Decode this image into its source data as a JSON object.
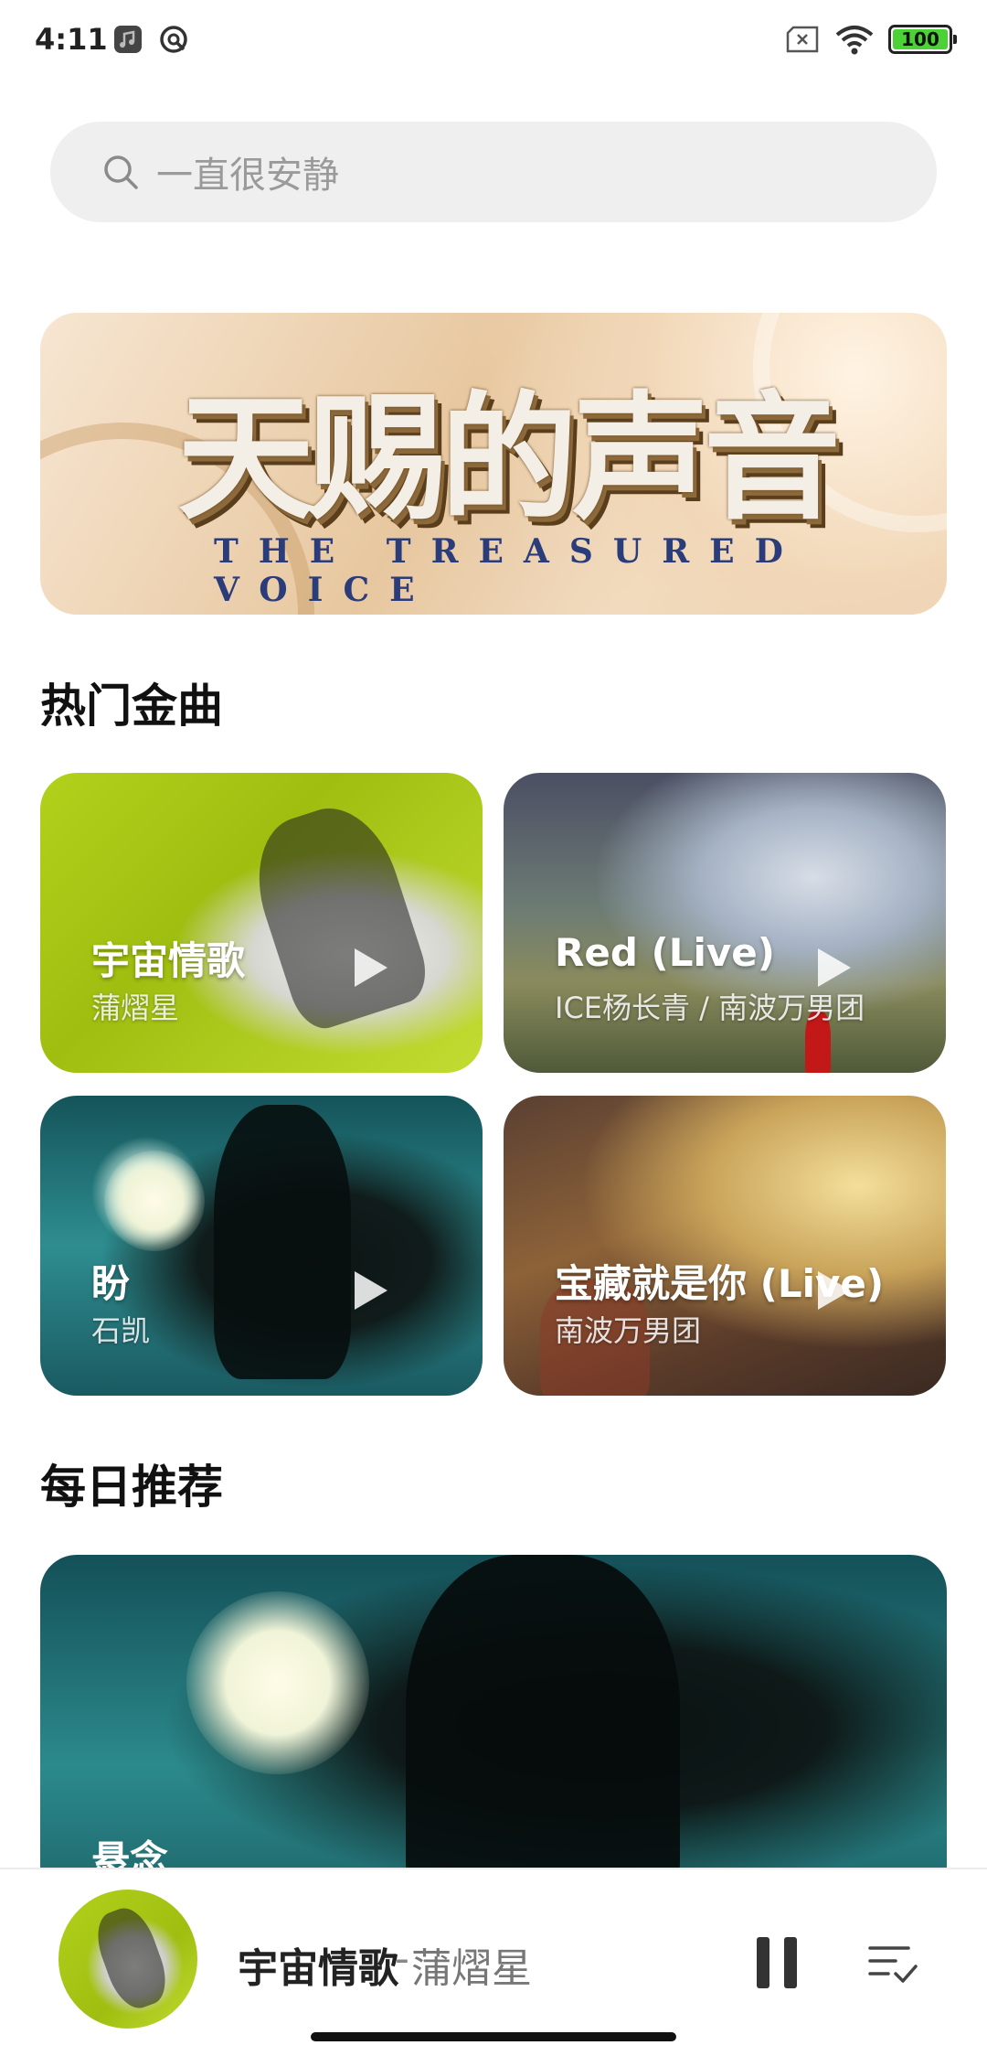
{
  "status_bar": {
    "time": "4:11",
    "battery": "100",
    "icons": [
      "music-app-icon",
      "sync-icon",
      "sim-icon",
      "wifi-icon",
      "battery-icon"
    ]
  },
  "search": {
    "placeholder": "一直很安静"
  },
  "banner": {
    "title": "天赐的声音",
    "subtitle": "THE TREASURED VOICE"
  },
  "hot_songs": {
    "title": "热门金曲",
    "items": [
      {
        "title": "宇宙情歌",
        "artist": "蒲熠星"
      },
      {
        "title": "Red (Live)",
        "artist": "ICE杨长青 / 南波万男团"
      },
      {
        "title": "盼",
        "artist": "石凯"
      },
      {
        "title": "宝藏就是你 (Live)",
        "artist": "南波万男团"
      }
    ]
  },
  "daily": {
    "title": "每日推荐",
    "card_title": "悬念"
  },
  "player": {
    "song": "宇宙情歌",
    "separator": "-",
    "artist": "蒲熠星"
  },
  "colors": {
    "accent_green": "#b2d11c",
    "battery_green": "#4cd137",
    "search_bg": "#efefef"
  }
}
